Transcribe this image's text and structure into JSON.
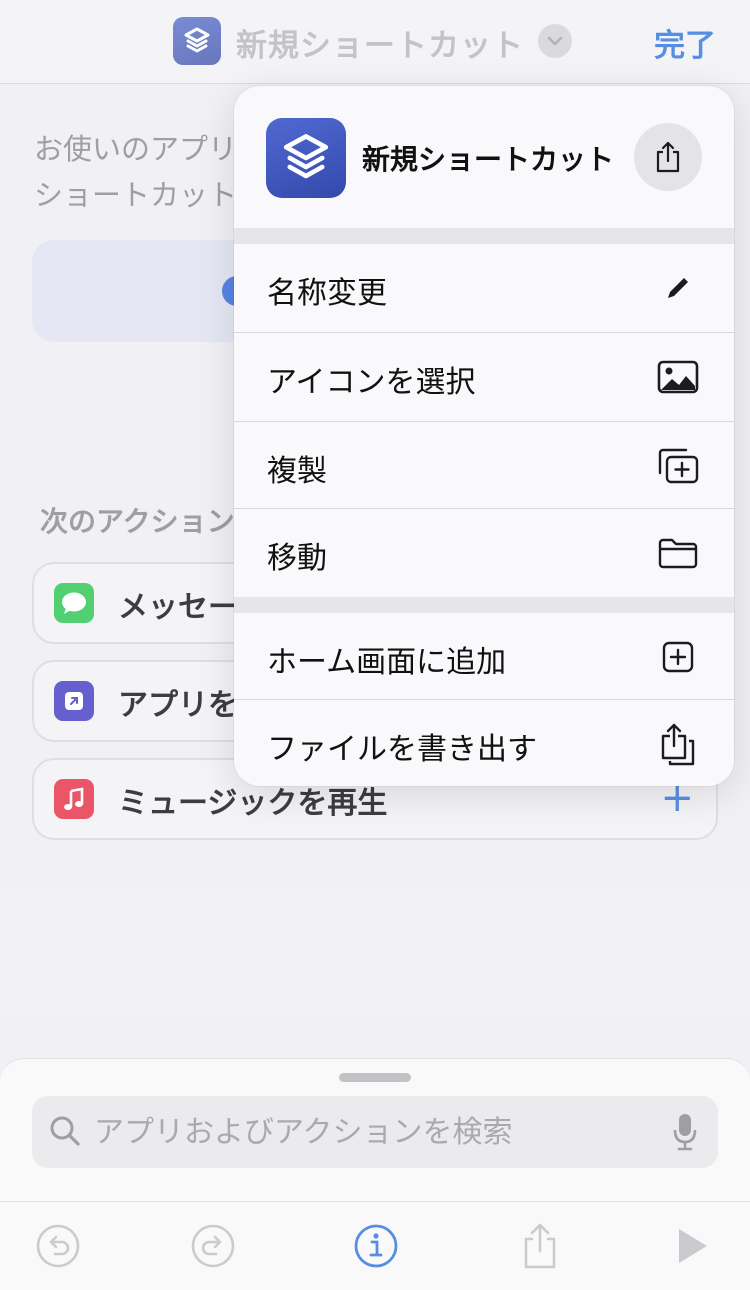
{
  "nav": {
    "title": "新規ショートカット",
    "done_label": "完了",
    "icon": "shortcuts-icon",
    "chevron_icon": "chevron-down-icon"
  },
  "intro": {
    "line1": "お使いのアプリ",
    "line2": "ショートカット"
  },
  "suggestions": {
    "header": "次のアクション",
    "items": [
      {
        "label": "メッセー",
        "icon": "messages-icon",
        "color": "#34c759"
      },
      {
        "label": "アプリを",
        "icon": "open-app-icon",
        "color": "#4b45c6"
      },
      {
        "label": "ミュージックを再生",
        "icon": "music-icon",
        "color": "#e8384e"
      }
    ],
    "add_label": "+"
  },
  "popup": {
    "title": "新規ショートカット",
    "share_icon": "share-icon",
    "group1": [
      {
        "label": "名称変更",
        "icon": "pencil-icon"
      },
      {
        "label": "アイコンを選択",
        "icon": "photo-icon"
      },
      {
        "label": "複製",
        "icon": "duplicate-icon"
      },
      {
        "label": "移動",
        "icon": "folder-icon"
      }
    ],
    "group2": [
      {
        "label": "ホーム画面に追加",
        "icon": "add-square-icon"
      },
      {
        "label": "ファイルを書き出す",
        "icon": "export-icon"
      }
    ]
  },
  "search": {
    "placeholder": "アプリおよびアクションを検索",
    "value": ""
  },
  "toolbar": {
    "items": [
      "undo-icon",
      "redo-icon",
      "info-icon",
      "share-icon",
      "play-icon"
    ]
  },
  "colors": {
    "accent": "#3a7be0",
    "shortcut_icon": "#4459bd"
  }
}
